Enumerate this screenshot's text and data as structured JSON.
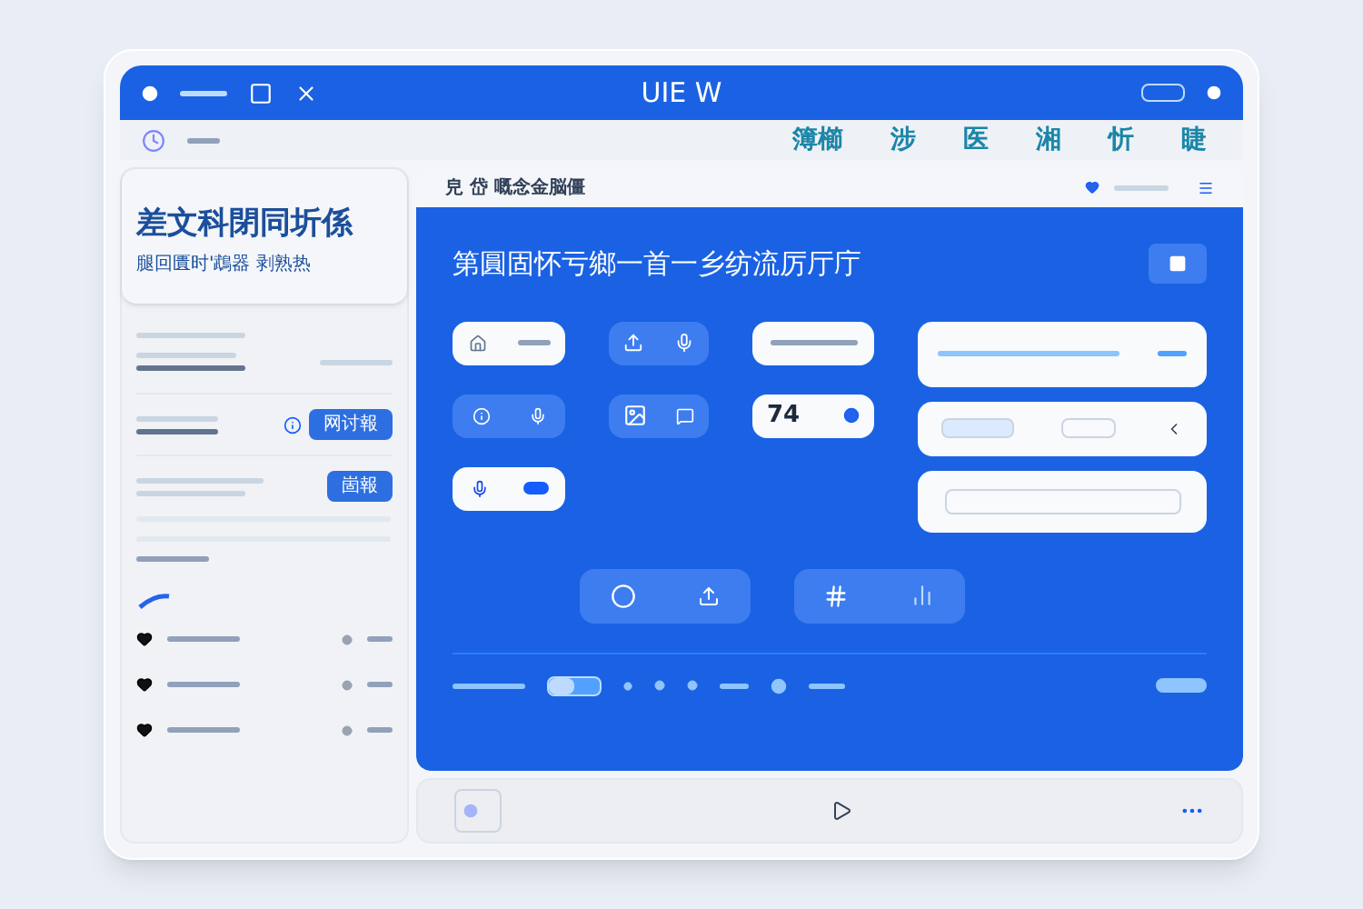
{
  "window": {
    "title": "UIE W"
  },
  "toolbar": {
    "tabs": [
      {
        "label": "簿櫛",
        "selected": false
      },
      {
        "label": "涉",
        "selected": false
      },
      {
        "label": "医",
        "selected": false
      },
      {
        "label": "湘",
        "selected": false
      },
      {
        "label": "忻",
        "selected": false
      },
      {
        "label": "睫",
        "selected": false
      }
    ]
  },
  "sidebar": {
    "title": "差文科閉同圻係",
    "subtitle": "腿回匱时'鵡器 剥熟热",
    "buttons": [
      "网讨報",
      "崮報"
    ]
  },
  "header": {
    "title": "皃 岱 嘅念金脳僵"
  },
  "hero": {
    "heading": "第圓固怀亏鄉一首一乡纺流厉厅庁"
  },
  "widgets": {
    "counter": "74"
  },
  "controls": {
    "toggle": {
      "on": false
    }
  }
}
